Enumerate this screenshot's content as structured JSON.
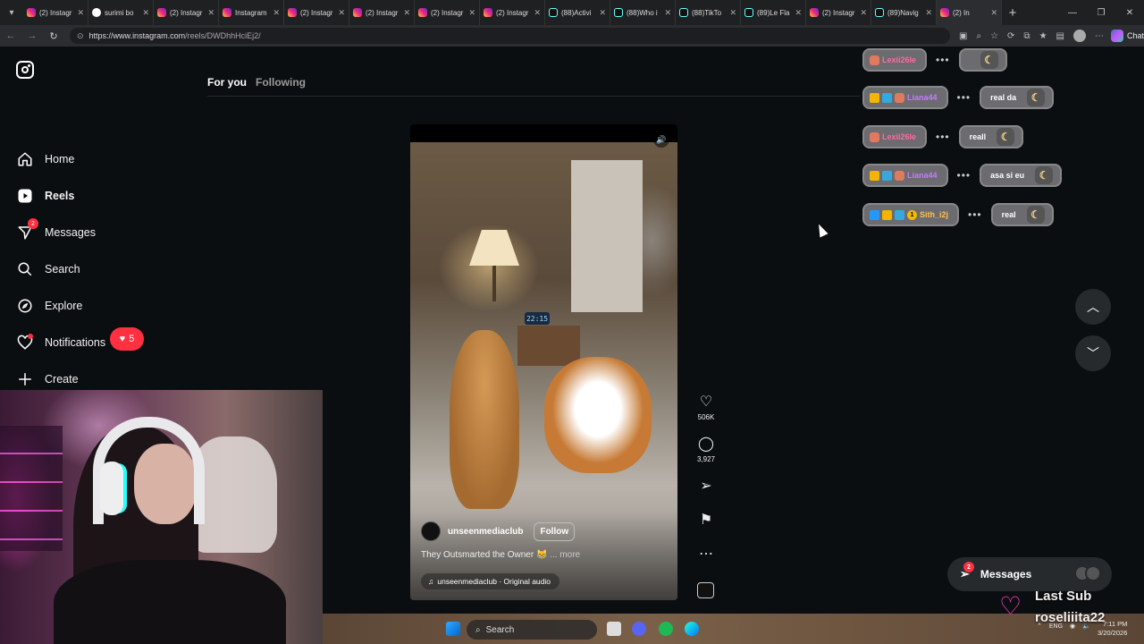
{
  "browser": {
    "tabs": [
      {
        "title": "(2) Instagr",
        "icon": "instagram"
      },
      {
        "title": "surimi bo",
        "icon": "google"
      },
      {
        "title": "(2) Instagr",
        "icon": "instagram"
      },
      {
        "title": "Instagram",
        "icon": "instagram"
      },
      {
        "title": "(2) Instagr",
        "icon": "instagram"
      },
      {
        "title": "(2) Instagr",
        "icon": "instagram"
      },
      {
        "title": "(2) Instagr",
        "icon": "instagram"
      },
      {
        "title": "(2) Instagr",
        "icon": "instagram"
      },
      {
        "title": "(88)Activi",
        "icon": "tiktok"
      },
      {
        "title": "(88)Who i",
        "icon": "tiktok"
      },
      {
        "title": "(88)TikTo",
        "icon": "tiktok"
      },
      {
        "title": "(89)Le Fla",
        "icon": "tiktok"
      },
      {
        "title": "(2) Instagr",
        "icon": "instagram"
      },
      {
        "title": "(89)Navig",
        "icon": "tiktok"
      },
      {
        "title": "(2) In",
        "icon": "instagram"
      }
    ],
    "url_host": "https://www.instagram.com",
    "url_path": "/reels/DWDhhHciEj2/",
    "chat_label": "Chat"
  },
  "sidebar": {
    "items": [
      {
        "label": "Home",
        "icon": "home-icon"
      },
      {
        "label": "Reels",
        "icon": "reels-icon"
      },
      {
        "label": "Messages",
        "icon": "messages-icon",
        "badge": "2"
      },
      {
        "label": "Search",
        "icon": "search-icon"
      },
      {
        "label": "Explore",
        "icon": "explore-icon"
      },
      {
        "label": "Notifications",
        "icon": "heart-icon"
      },
      {
        "label": "Create",
        "icon": "plus-icon"
      }
    ],
    "notifications_count": "5"
  },
  "feed_tabs": {
    "for_you": "For you",
    "following": "Following"
  },
  "reel": {
    "clock_text": "22:15",
    "author": "unseenmediaclub",
    "follow_label": "Follow",
    "caption": "They Outsmarted the Owner 😹",
    "more_label": "... more",
    "audio": "unseenmediaclub · Original audio",
    "likes": "506K",
    "comments": "3,927"
  },
  "chat": [
    {
      "name": "Lexii26le",
      "style": "pink",
      "chips": [
        "cup"
      ],
      "message": ""
    },
    {
      "name": "Liana44",
      "style": "violet",
      "chips": [
        "crown",
        "grid",
        "cup"
      ],
      "message": "real da"
    },
    {
      "name": "Lexii26le",
      "style": "pink",
      "chips": [
        "cup"
      ],
      "message": "reall"
    },
    {
      "name": "Liana44",
      "style": "violet",
      "chips": [
        "crown",
        "grid",
        "cup"
      ],
      "message": "asa si eu"
    },
    {
      "name": "Sith_i2j",
      "style": "gold",
      "chips": [
        "blue",
        "crown",
        "grid",
        "one"
      ],
      "message": "real"
    }
  ],
  "messages_bubble": {
    "label": "Messages",
    "badge": "2"
  },
  "last_sub": {
    "title": "Last Sub",
    "name": "roseliiita22"
  },
  "taskbar": {
    "search_label": "Search",
    "lang": "ENG",
    "time": "7:11 PM",
    "date": "3/20/2026"
  }
}
